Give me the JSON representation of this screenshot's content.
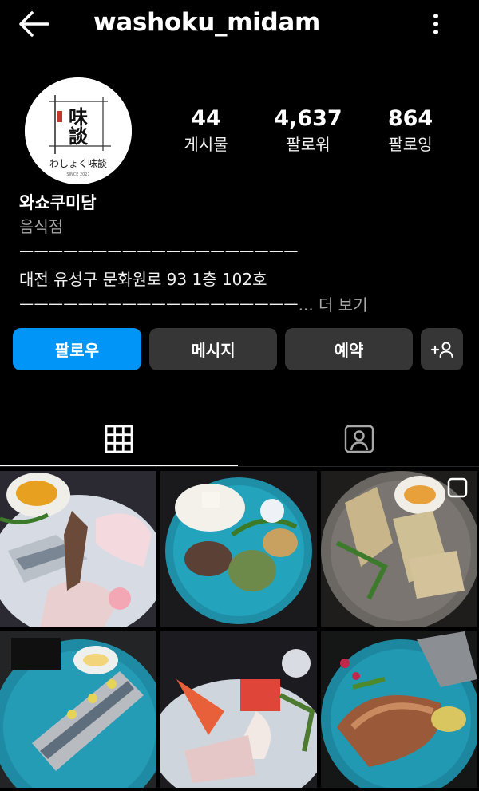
{
  "header": {
    "username": "washoku_midam",
    "back_icon": "arrow-left-icon",
    "options_icon": "more-vertical-icon"
  },
  "profile": {
    "avatar": {
      "logo_kanji_top": "味",
      "logo_kanji_bottom": "談",
      "logo_caption": "わしょく味談",
      "logo_small": "SINCE 2021"
    },
    "stats": [
      {
        "value": "44",
        "label": "게시물"
      },
      {
        "value": "4,637",
        "label": "팔로워"
      },
      {
        "value": "864",
        "label": "팔로잉"
      }
    ],
    "name": "와쇼쿠미담",
    "category": "음식점",
    "bio_lines": [
      "ㅡㅡㅡㅡㅡㅡㅡㅡㅡㅡㅡㅡㅡㅡㅡㅡㅡㅡㅡ",
      "대전 유성구 문화원로 93 1층 102호",
      "ㅡㅡㅡㅡㅡㅡㅡㅡㅡㅡㅡㅡㅡㅡㅡㅡㅡㅡㅡ"
    ],
    "more_label": "... 더 보기"
  },
  "actions": {
    "follow": "팔로우",
    "message": "메시지",
    "reserve": "예약",
    "suggest_icon": "add-person-icon"
  },
  "tabs": [
    {
      "name": "grid",
      "icon": "grid-icon",
      "active": true
    },
    {
      "name": "tagged",
      "icon": "tagged-person-icon",
      "active": false
    }
  ],
  "colors": {
    "background": "#000000",
    "primary_button": "#0095f6",
    "secondary_button": "#363636",
    "muted_text": "#a8a8a8"
  }
}
